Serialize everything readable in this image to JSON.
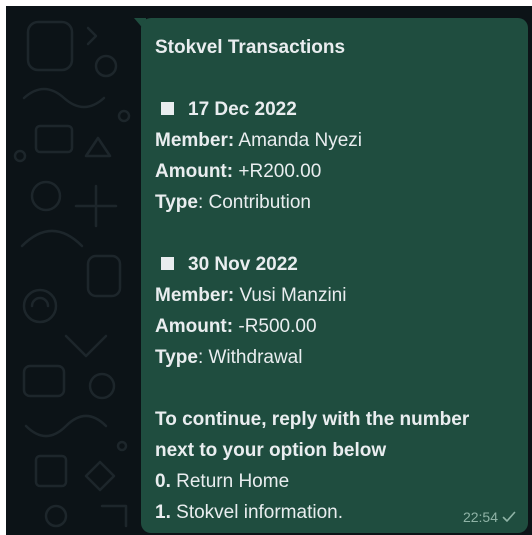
{
  "message": {
    "title": "Stokvel Transactions",
    "transactions": [
      {
        "date": "17 Dec 2022",
        "member_label": "Member:",
        "member": "Amanda Nyezi",
        "amount_label": "Amount:",
        "amount": "+R200.00",
        "type_label": "Type",
        "type": "Contribution"
      },
      {
        "date": "30 Nov 2022",
        "member_label": "Member:",
        "member": "Vusi Manzini",
        "amount_label": "Amount:",
        "amount": "-R500.00",
        "type_label": "Type",
        "type": "Withdrawal"
      }
    ],
    "prompt_line1": "To continue, reply with the number",
    "prompt_line2": "next to your option below",
    "options": [
      {
        "number": "0.",
        "label": "Return Home"
      },
      {
        "number": "1.",
        "label": "Stokvel information."
      }
    ],
    "time": "22:54",
    "status_icon": "single-check-icon"
  },
  "colors": {
    "background": "#0c1317",
    "bubble": "#1f4d3f",
    "text": "#e9edef",
    "meta": "#8fb3a6"
  }
}
